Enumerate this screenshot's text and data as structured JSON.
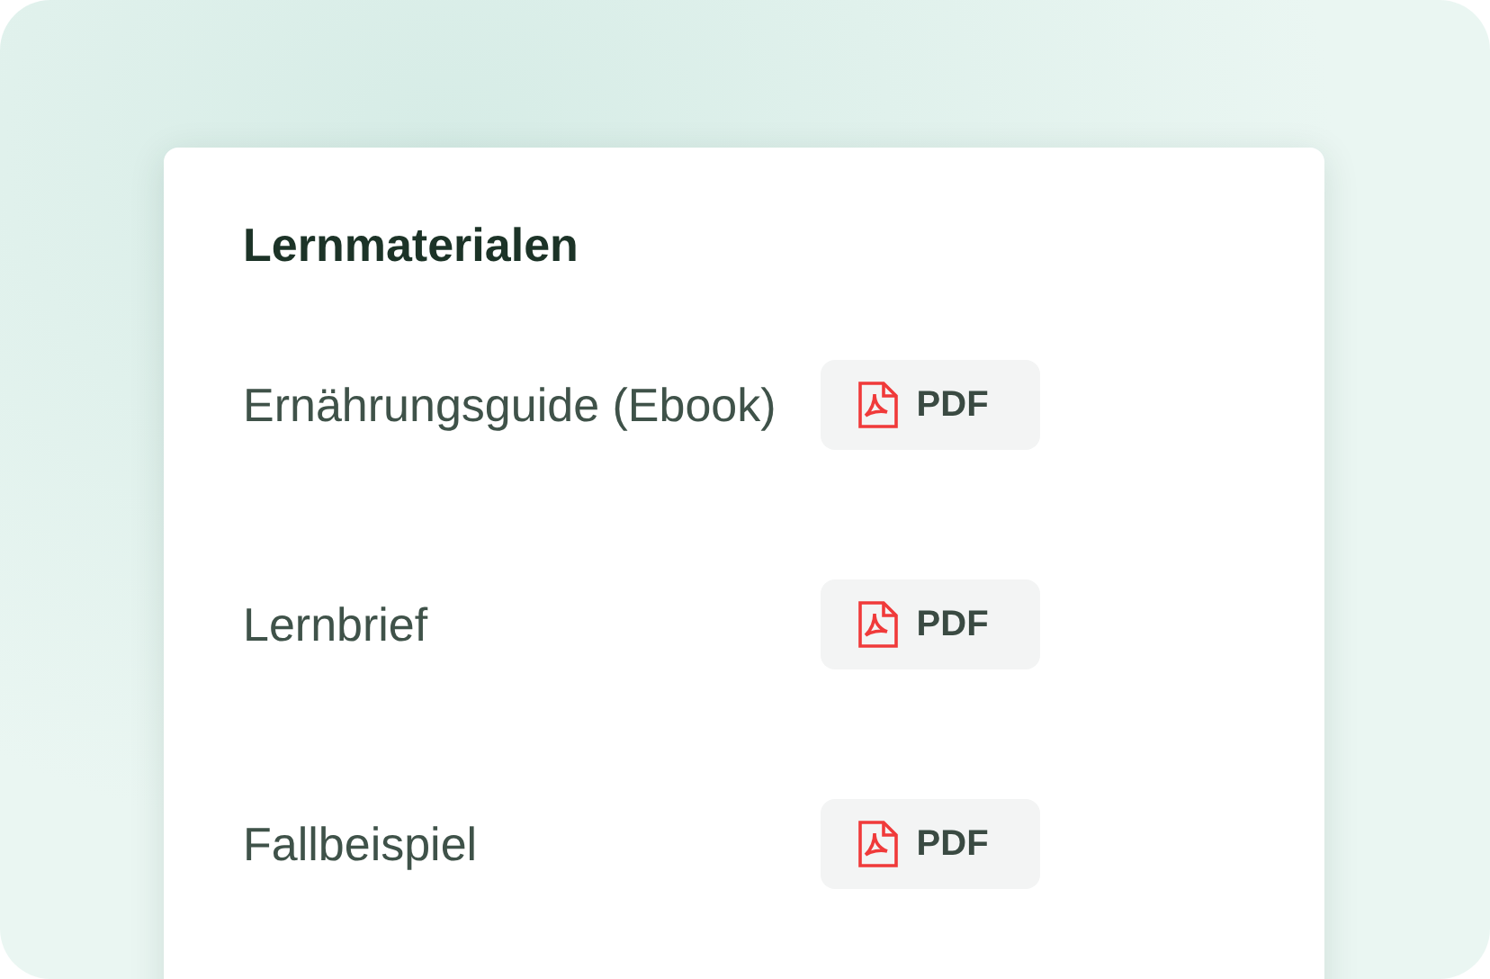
{
  "card": {
    "title": "Lernmaterialen",
    "items": [
      {
        "name": "Ernährungsguide (Ebook)",
        "button": "PDF"
      },
      {
        "name": "Lernbrief",
        "button": "PDF"
      },
      {
        "name": "Fallbeispiel",
        "button": "PDF"
      }
    ]
  }
}
